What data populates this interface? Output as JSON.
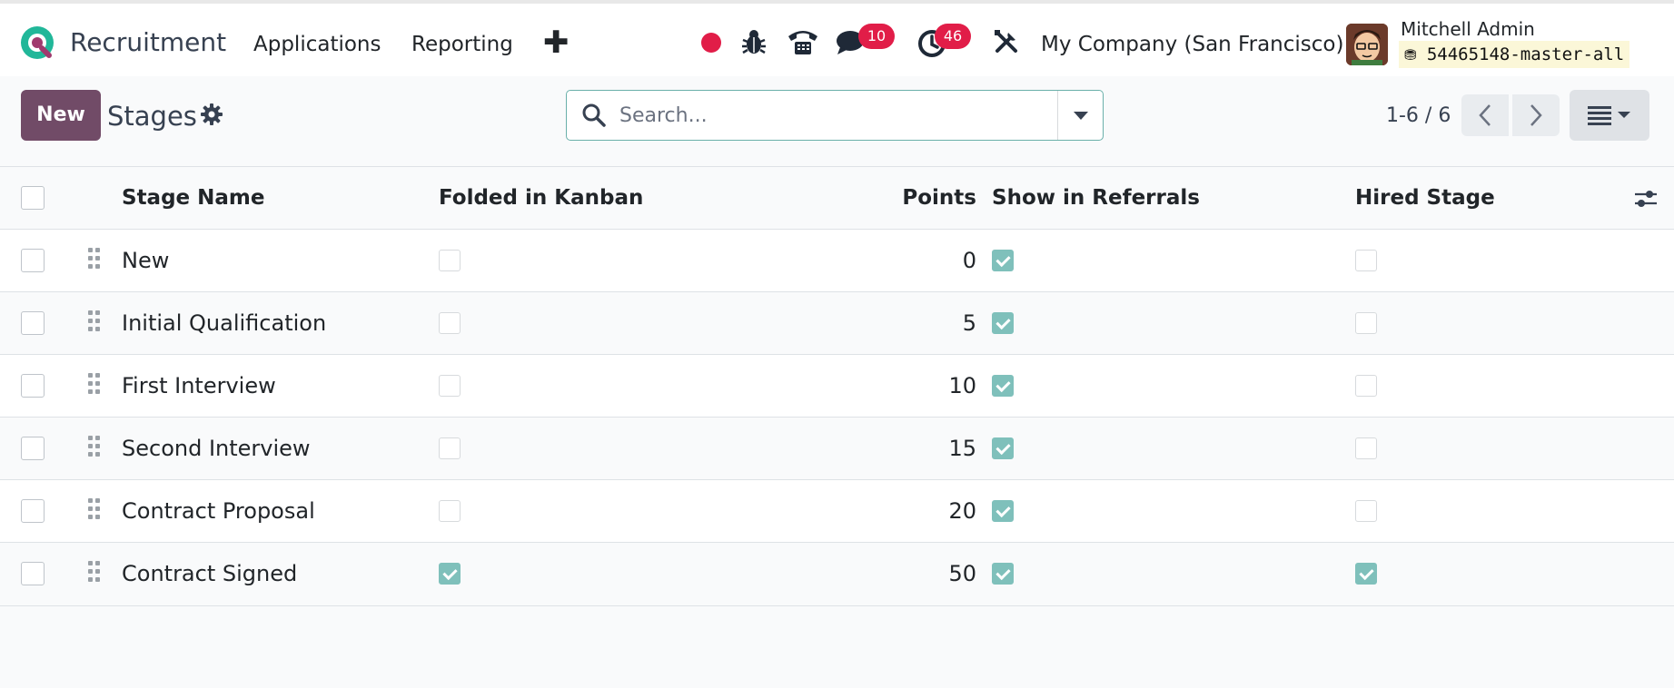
{
  "navbar": {
    "app_name": "Recruitment",
    "menu": [
      "Applications",
      "Reporting"
    ],
    "plus": "✚",
    "messages_count": "10",
    "activities_count": "46",
    "company": "My Company (San Francisco)",
    "user_name": "Mitchell Admin",
    "database": "54465148-master-all"
  },
  "control": {
    "new_label": "New",
    "title": "Stages",
    "search_placeholder": "Search...",
    "pager": "1-6 / 6"
  },
  "table": {
    "columns": [
      "Stage Name",
      "Folded in Kanban",
      "Points",
      "Show in Referrals",
      "Hired Stage"
    ],
    "rows": [
      {
        "name": "New",
        "folded": false,
        "points": "0",
        "referrals": true,
        "hired": false
      },
      {
        "name": "Initial Qualification",
        "folded": false,
        "points": "5",
        "referrals": true,
        "hired": false
      },
      {
        "name": "First Interview",
        "folded": false,
        "points": "10",
        "referrals": true,
        "hired": false
      },
      {
        "name": "Second Interview",
        "folded": false,
        "points": "15",
        "referrals": true,
        "hired": false
      },
      {
        "name": "Contract Proposal",
        "folded": false,
        "points": "20",
        "referrals": true,
        "hired": false
      },
      {
        "name": "Contract Signed",
        "folded": true,
        "points": "50",
        "referrals": true,
        "hired": true
      }
    ]
  },
  "colors": {
    "brand": "#714b67",
    "accent": "#017e84",
    "checked": "#7fc0bb",
    "badge": "#e11d48"
  }
}
